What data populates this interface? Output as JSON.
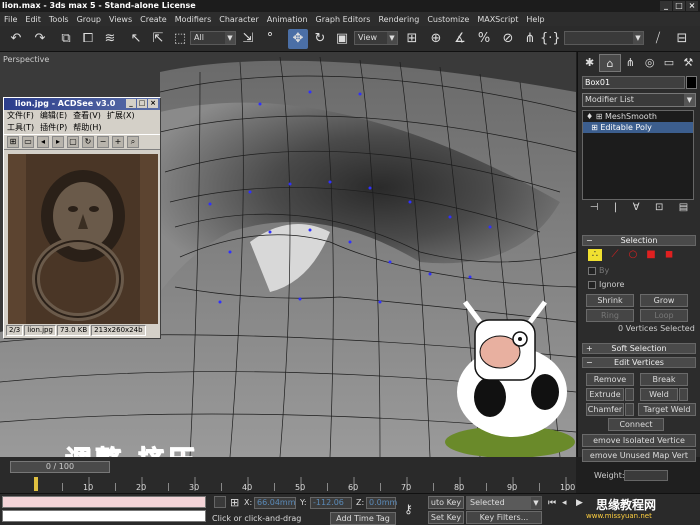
{
  "window": {
    "title": "lion.max - 3ds max 5 - Stand-alone License"
  },
  "menu": [
    "File",
    "Edit",
    "Tools",
    "Group",
    "Views",
    "Create",
    "Modifiers",
    "Character",
    "Animation",
    "Graph Editors",
    "Rendering",
    "Customize",
    "MAXScript",
    "Help"
  ],
  "toolbar": {
    "filter_value": "All",
    "coord_value": "View",
    "extra_value": ""
  },
  "viewport": {
    "label": "Perspective"
  },
  "acdsee": {
    "title": "lion.jpg - ACDSee v3.0",
    "menu_row1": [
      "文件(F)",
      "编辑(E)",
      "查看(V)",
      "扩展(X)"
    ],
    "menu_row2": [
      "工具(T)",
      "插件(P)",
      "帮助(H)"
    ],
    "status": [
      "2/3",
      "lion.jpg",
      "73.0 KB",
      "213x260x24b"
    ]
  },
  "caption": "调整 挤压",
  "command_panel": {
    "object_name": "Box01",
    "modifier_list": "Modifier List",
    "stack": [
      "MeshSmooth",
      "Editable Poly"
    ],
    "selection": {
      "header": "Selection",
      "by_label": "By",
      "ignore_label": "Ignore",
      "shrink": "Shrink",
      "grow": "Grow",
      "ring": "Ring",
      "loop": "Loop",
      "status": "0 Vertices Selected"
    },
    "soft_selection": "Soft Selection",
    "edit_vertices": {
      "header": "Edit Vertices",
      "remove": "Remove",
      "break": "Break",
      "extrude": "Extrude",
      "weld": "Weld",
      "chamfer": "Chamfer",
      "target_weld": "Target Weld",
      "connect": "Connect",
      "remove_isolated": "emove Isolated Vertice",
      "remove_unused": "emove Unused Map Vert",
      "weight_label": "Weight:"
    }
  },
  "timeline": {
    "slider": "0 / 100",
    "ticks": [
      "10",
      "20",
      "30",
      "40",
      "50",
      "60",
      "70",
      "80",
      "90",
      "100"
    ]
  },
  "status": {
    "x_label": "X:",
    "x_value": "66.04mm",
    "y_label": "Y:",
    "y_value": "-112.06",
    "z_label": "Z:",
    "z_value": "0.0mm",
    "prompt": "Click or click-and-drag",
    "add_time_tag": "Add Time Tag",
    "auto_key": "uto Key",
    "selected": "Selected",
    "set_key": "Set Key",
    "key_filters": "Key Filters..."
  },
  "watermark": {
    "text": "思缘教程网",
    "url": "www.missyuan.net"
  },
  "colors": {
    "accent": "#4b6fa6",
    "selection_yellow": "#f0e030",
    "viewport_bg": "#3a3a3a",
    "caption_red": "#e02020"
  }
}
